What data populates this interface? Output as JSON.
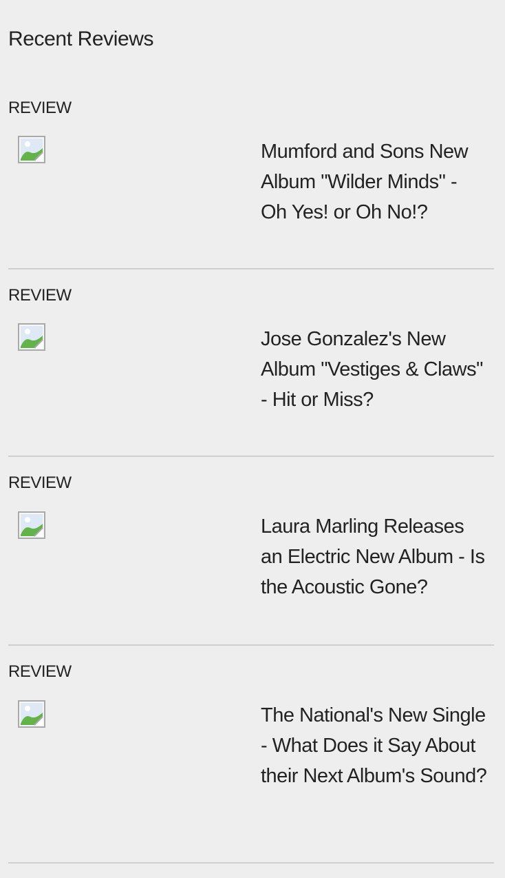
{
  "section": {
    "title": "Recent Reviews"
  },
  "reviews": [
    {
      "kicker": "REVIEW",
      "headline": "Mumford and Sons New Album \"Wilder Minds\" - Oh Yes! or Oh No!?"
    },
    {
      "kicker": "REVIEW",
      "headline": "Jose Gonzalez's New Album \"Vestiges & Claws\" - Hit or Miss?"
    },
    {
      "kicker": "REVIEW",
      "headline": "Laura Marling Releases an Electric New Album - Is the Acoustic Gone?"
    },
    {
      "kicker": "REVIEW",
      "headline": "The National's New Single - What Does it Say About their Next Album's Sound?"
    }
  ],
  "icons": {
    "thumbnail": "broken-image-icon"
  },
  "colors": {
    "background": "#eeeeee",
    "text": "#222222",
    "divider": "#cfcfcf"
  }
}
